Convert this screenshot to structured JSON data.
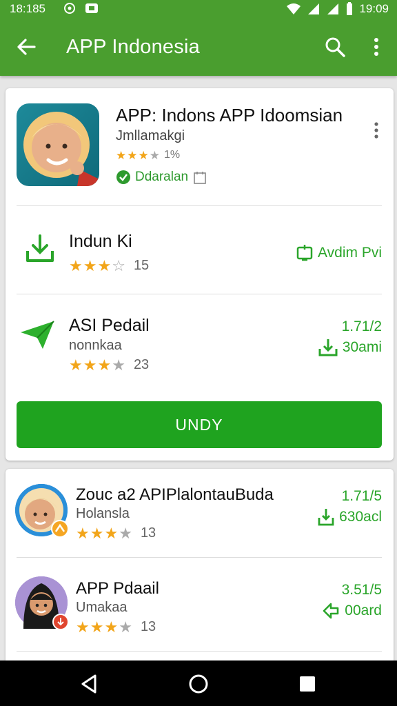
{
  "status": {
    "time_left": "18:185",
    "time_right": "19:09"
  },
  "toolbar": {
    "title": "APP Indonesia",
    "icons": [
      "arrow-back-icon",
      "search-icon",
      "more-vert-icon"
    ]
  },
  "featured": {
    "title": "APP: Indons APP Idoomsian",
    "developer": "Jmllamakgi",
    "rating_count": "1%",
    "stars": 3,
    "badge": "Ddaralan"
  },
  "list1": [
    {
      "name": "Indun Ki",
      "developer": "",
      "stars": 3,
      "half": true,
      "count": "15",
      "right_top": "",
      "right_action": "Avdim Pvi",
      "icon": "download-icon"
    },
    {
      "name": "ASI Pedail",
      "developer": "nonnkaa",
      "stars": 3,
      "half": false,
      "count": "23",
      "right_top": "1.71/2",
      "right_action": "30ami",
      "icon": "send-icon"
    }
  ],
  "install_label": "UNDY",
  "list2": [
    {
      "name": "Zouc a2 APIPlalontauBuda",
      "developer": "Holansla",
      "stars": 3,
      "count": "13",
      "right_top": "1.71/5",
      "right_action": "630acl"
    },
    {
      "name": "APP Pdaail",
      "developer": "Umakaa",
      "stars": 3,
      "count": "13",
      "right_top": "3.51/5",
      "right_action": "00ard"
    }
  ],
  "colors": {
    "app_bar": "#4a9e2f",
    "accent": "#1fa31f",
    "star": "#f2a51a"
  }
}
